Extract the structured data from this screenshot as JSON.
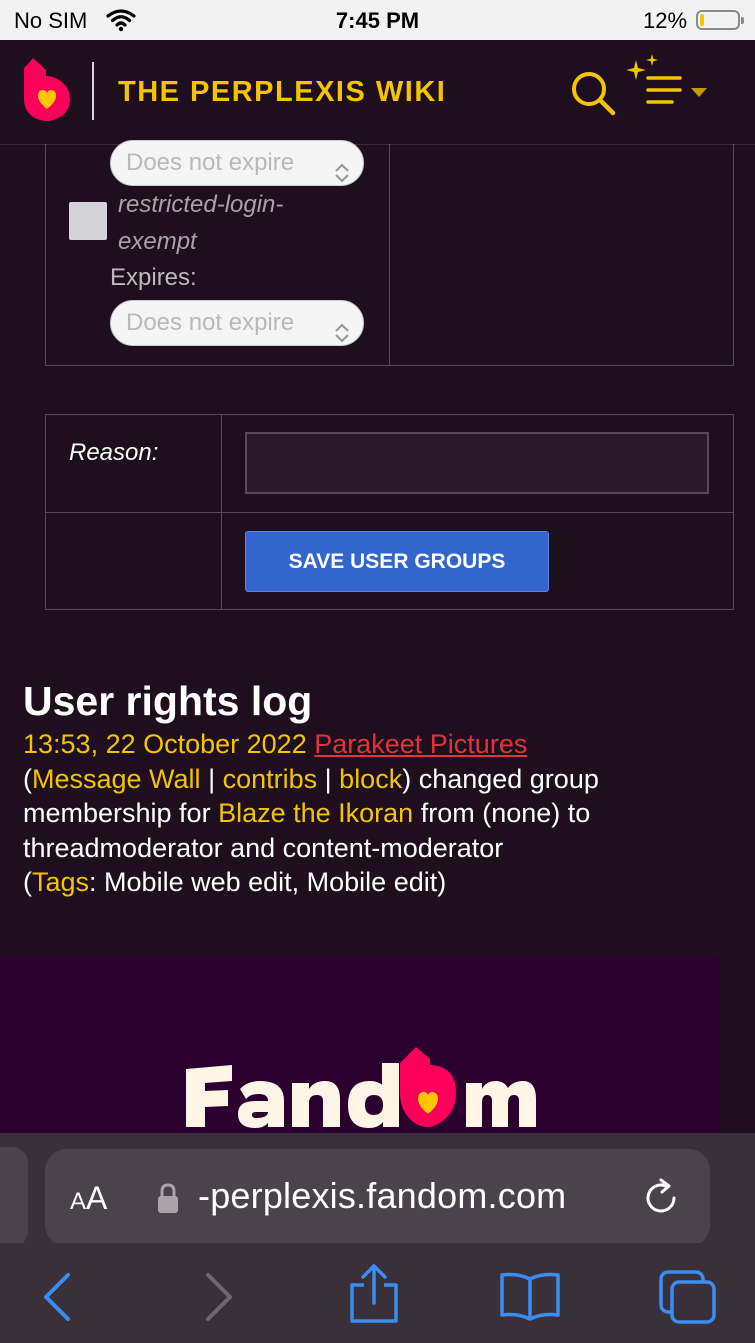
{
  "status_bar": {
    "carrier": "No SIM",
    "time": "7:45 PM",
    "battery_percent": "12%",
    "battery_level": 0.12,
    "battery_color": "#f3c400"
  },
  "header": {
    "title": "THE PERPLEXIS WIKI",
    "icons": [
      "fandom-flame-logo",
      "search-icon",
      "ai-menu-icon",
      "chevron-down-icon"
    ],
    "accent_color": "#f3c400"
  },
  "rights_form": {
    "top_select_value": "Does not expire",
    "right_name": "restricted-login-exempt",
    "right_name_line1": "restricted-login-",
    "right_name_line2": "exempt",
    "right_checked": false,
    "expires_label": "Expires:",
    "expires_select_value": "Does not expire"
  },
  "reason_form": {
    "reason_label": "Reason:",
    "reason_value": "",
    "save_label": "SAVE USER GROUPS",
    "save_color": "#3366cc"
  },
  "log": {
    "heading": "User rights log",
    "timestamp": "13:53, 22 October 2022",
    "user": "Parakeet Pictures",
    "paren_open": "(",
    "message_wall": "Message Wall",
    "sep1": " | ",
    "contribs": "contribs",
    "sep2": " | ",
    "block": "block",
    "text1": ") changed group membership for ",
    "target": "Blaze the Ikoran",
    "text2": " from (none) to threadmoderator and content-moderator",
    "tags_open": "(",
    "tags_label": "Tags",
    "tags_value": ": Mobile web edit, Mobile edit)"
  },
  "footer": {
    "wordmark": "Fandom"
  },
  "browser": {
    "aa_label_big": "A",
    "aa_label_small": "A",
    "url": "-perplexis.fandom.com",
    "toolbar_icons": [
      "back-icon",
      "forward-icon",
      "share-icon",
      "bookmarks-icon",
      "tabs-icon"
    ]
  }
}
